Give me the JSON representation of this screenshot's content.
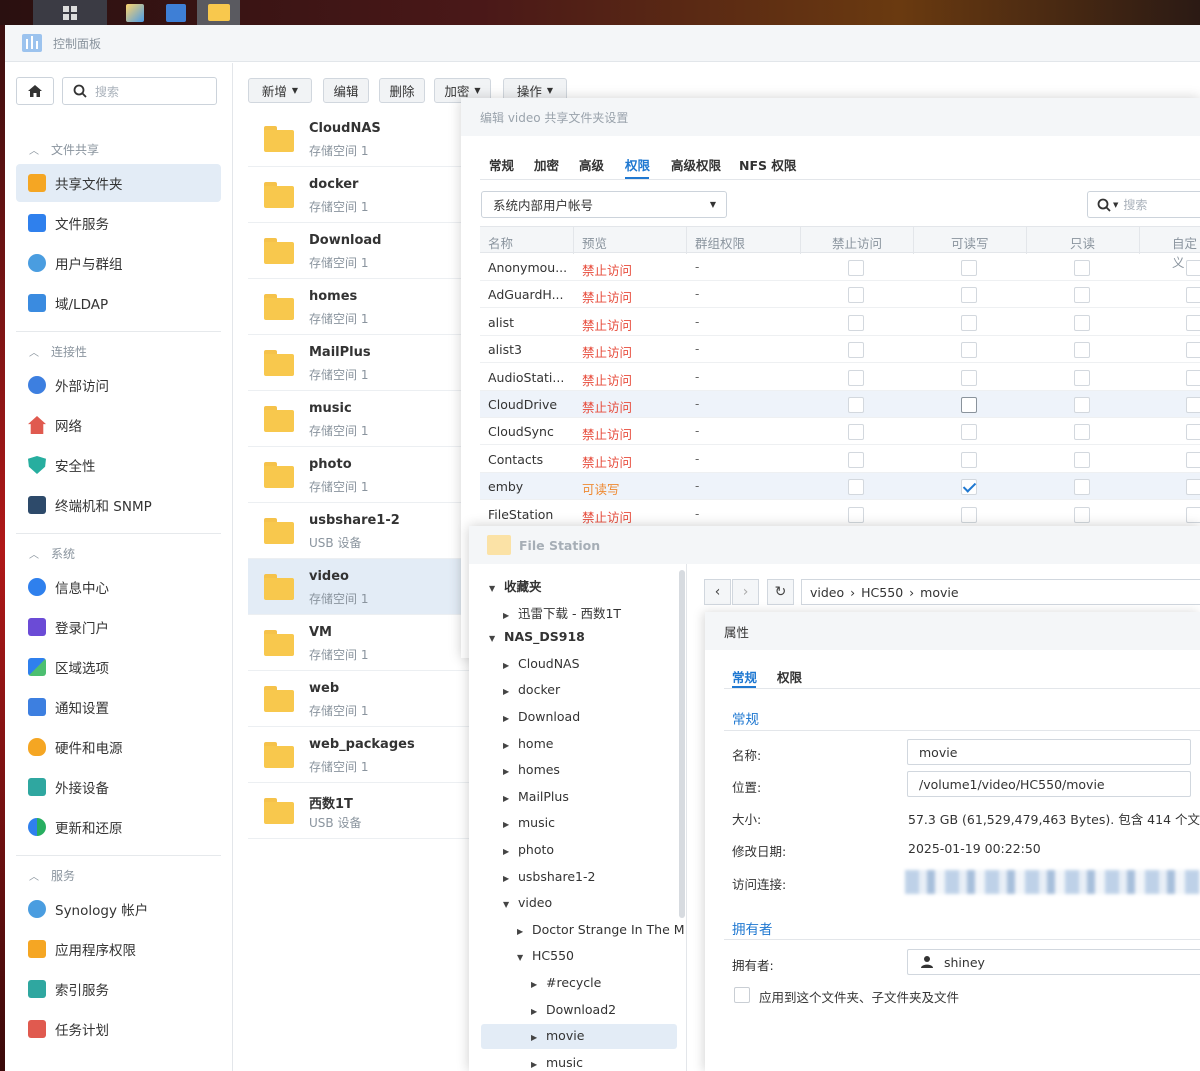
{
  "controlPanel": {
    "title": "控制面板"
  },
  "sidebar": {
    "search_placeholder": "搜索",
    "sections": [
      {
        "label": "文件共享",
        "items": [
          {
            "label": "共享文件夹"
          },
          {
            "label": "文件服务"
          },
          {
            "label": "用户与群组"
          },
          {
            "label": "域/LDAP"
          }
        ]
      },
      {
        "label": "连接性",
        "items": [
          {
            "label": "外部访问"
          },
          {
            "label": "网络"
          },
          {
            "label": "安全性"
          },
          {
            "label": "终端机和 SNMP"
          }
        ]
      },
      {
        "label": "系统",
        "items": [
          {
            "label": "信息中心"
          },
          {
            "label": "登录门户"
          },
          {
            "label": "区域选项"
          },
          {
            "label": "通知设置"
          },
          {
            "label": "硬件和电源"
          },
          {
            "label": "外接设备"
          },
          {
            "label": "更新和还原"
          }
        ]
      },
      {
        "label": "服务",
        "items": [
          {
            "label": "Synology 帐户"
          },
          {
            "label": "应用程序权限"
          },
          {
            "label": "索引服务"
          },
          {
            "label": "任务计划"
          }
        ]
      }
    ]
  },
  "toolbar": {
    "create": "新增",
    "edit": "编辑",
    "delete": "删除",
    "encrypt": "加密",
    "action": "操作"
  },
  "shares": [
    {
      "name": "CloudNAS",
      "sub": "存储空间 1"
    },
    {
      "name": "docker",
      "sub": "存储空间 1"
    },
    {
      "name": "Download",
      "sub": "存储空间 1"
    },
    {
      "name": "homes",
      "sub": "存储空间 1"
    },
    {
      "name": "MailPlus",
      "sub": "存储空间 1"
    },
    {
      "name": "music",
      "sub": "存储空间 1"
    },
    {
      "name": "photo",
      "sub": "存储空间 1"
    },
    {
      "name": "usbshare1-2",
      "sub": "USB 设备"
    },
    {
      "name": "video",
      "sub": "存储空间 1"
    },
    {
      "name": "VM",
      "sub": "存储空间 1"
    },
    {
      "name": "web",
      "sub": "存储空间 1"
    },
    {
      "name": "web_packages",
      "sub": "存储空间 1"
    },
    {
      "name": "西数1T",
      "sub": "USB 设备"
    }
  ],
  "editDialog": {
    "title": "编辑 video 共享文件夹设置",
    "tabs": [
      "常规",
      "加密",
      "高级",
      "权限",
      "高级权限",
      "NFS 权限"
    ],
    "active_tab": "权限",
    "user_source": "系统内部用户帐号",
    "search_placeholder": "搜索",
    "columns": [
      "名称",
      "预览",
      "群组权限",
      "禁止访问",
      "可读写",
      "只读",
      "自定义"
    ],
    "rows": [
      {
        "name": "Anonymou...",
        "preview": "禁止访问",
        "group": "-"
      },
      {
        "name": "AdGuardH...",
        "preview": "禁止访问",
        "group": "-"
      },
      {
        "name": "alist",
        "preview": "禁止访问",
        "group": "-"
      },
      {
        "name": "alist3",
        "preview": "禁止访问",
        "group": "-"
      },
      {
        "name": "AudioStati...",
        "preview": "禁止访问",
        "group": "-"
      },
      {
        "name": "CloudDrive",
        "preview": "禁止访问",
        "group": "-"
      },
      {
        "name": "CloudSync",
        "preview": "禁止访问",
        "group": "-"
      },
      {
        "name": "Contacts",
        "preview": "禁止访问",
        "group": "-"
      },
      {
        "name": "emby",
        "preview": "可读写",
        "group": "-"
      },
      {
        "name": "FileStation",
        "preview": "禁止访问",
        "group": "-"
      }
    ]
  },
  "fileStation": {
    "title": "File Station",
    "path": [
      "video",
      "HC550",
      "movie"
    ],
    "path_sep": "›",
    "tree": {
      "favorites": "收藏夹",
      "fav_item": "迅雷下载 - 西数1T",
      "nas": "NAS_DS918",
      "folders": [
        "CloudNAS",
        "docker",
        "Download",
        "home",
        "homes",
        "MailPlus",
        "music",
        "photo",
        "usbshare1-2",
        "video"
      ],
      "video_children": [
        "Doctor Strange In The M"
      ],
      "hc550": "HC550",
      "hc550_children": [
        "#recycle",
        "Download2",
        "movie",
        "music"
      ]
    }
  },
  "properties": {
    "title": "属性",
    "tabs": [
      "常规",
      "权限"
    ],
    "section_general": "常规",
    "name_label": "名称:",
    "name_value": "movie",
    "location_label": "位置:",
    "location_value": "/volume1/video/HC550/movie",
    "size_label": "大小:",
    "size_value": "57.3 GB (61,529,479,463 Bytes). 包含 414 个文",
    "modified_label": "修改日期:",
    "modified_value": "2025-01-19 00:22:50",
    "link_label": "访问连接:",
    "section_owner": "拥有者",
    "owner_label": "拥有者:",
    "owner_value": "shiney",
    "apply_label": "应用到这个文件夹、子文件夹及文件"
  }
}
